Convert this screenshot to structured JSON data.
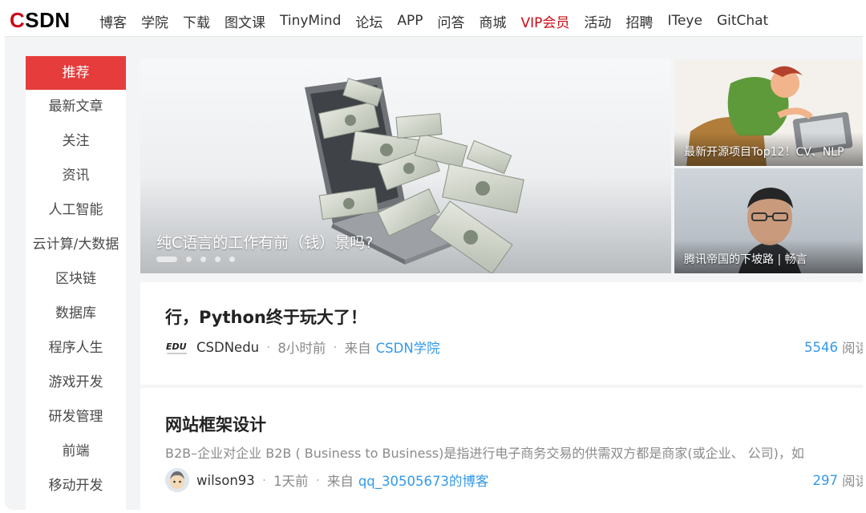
{
  "brand": {
    "logo_text_c": "C",
    "logo_text_rest": "SDN",
    "accent": "#ca0c16",
    "link_color": "#3399ea"
  },
  "nav": {
    "items": [
      "博客",
      "学院",
      "下载",
      "图文课",
      "TinyMind",
      "论坛",
      "APP",
      "问答",
      "商城",
      "VIP会员",
      "活动",
      "招聘",
      "ITeye",
      "GitChat"
    ],
    "highlighted": "VIP会员"
  },
  "sidebar": {
    "items": [
      "推荐",
      "最新文章",
      "关注",
      "资讯",
      "人工智能",
      "云计算/大数据",
      "区块链",
      "数据库",
      "程序人生",
      "游戏开发",
      "研发管理",
      "前端",
      "移动开发"
    ],
    "active": "推荐"
  },
  "banner": {
    "main": {
      "caption": "纯C语言的工作有前（钱）景吗?",
      "slides": 5,
      "active_slide": 1
    },
    "side": [
      {
        "caption": "最新开源项目Top12！CV、NLP"
      },
      {
        "caption": "腾讯帝国的下坡路 | 畅言"
      }
    ]
  },
  "feed": [
    {
      "title": "行，Python终于玩大了！",
      "avatar_text": "EDU",
      "author": "CSDNedu",
      "time": "8小时前",
      "source_prefix": "来自",
      "source": "CSDN学院",
      "reads": "5546",
      "reads_label": "阅读"
    },
    {
      "title": "网站框架设计",
      "summary": "B2B–企业对企业 B2B ( Business to Business)是指进行电子商务交易的供需双方都是商家(或企业、 公司)，如",
      "author": "wilson93",
      "time": "1天前",
      "source_prefix": "来自",
      "source": "qq_30505673的博客",
      "reads": "297",
      "reads_label": "阅读"
    }
  ]
}
